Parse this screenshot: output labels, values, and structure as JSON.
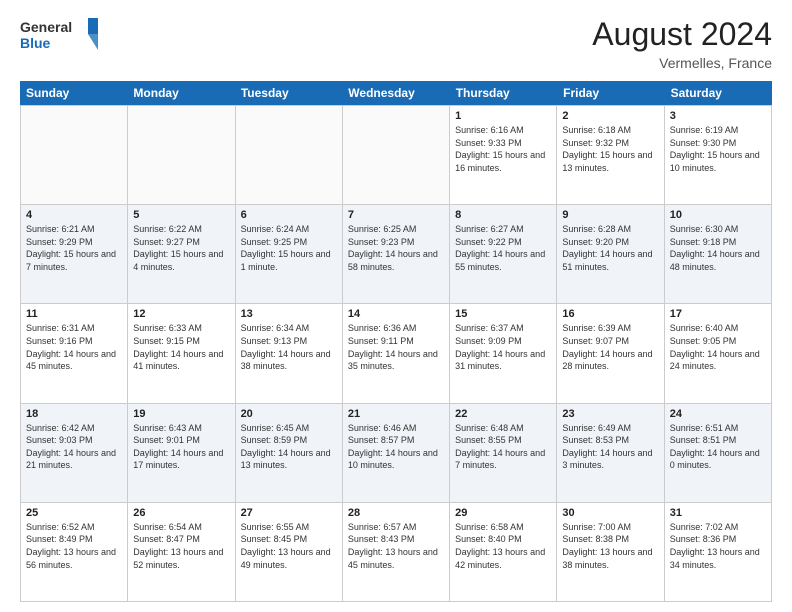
{
  "header": {
    "logo_general": "General",
    "logo_blue": "Blue",
    "month_title": "August 2024",
    "location": "Vermelles, France"
  },
  "weekdays": [
    "Sunday",
    "Monday",
    "Tuesday",
    "Wednesday",
    "Thursday",
    "Friday",
    "Saturday"
  ],
  "rows": [
    {
      "cells": [
        {
          "empty": true
        },
        {
          "empty": true
        },
        {
          "empty": true
        },
        {
          "empty": true
        },
        {
          "day": "1",
          "sunrise": "6:16 AM",
          "sunset": "9:33 PM",
          "daylight": "15 hours and 16 minutes."
        },
        {
          "day": "2",
          "sunrise": "6:18 AM",
          "sunset": "9:32 PM",
          "daylight": "15 hours and 13 minutes."
        },
        {
          "day": "3",
          "sunrise": "6:19 AM",
          "sunset": "9:30 PM",
          "daylight": "15 hours and 10 minutes."
        }
      ]
    },
    {
      "cells": [
        {
          "day": "4",
          "sunrise": "6:21 AM",
          "sunset": "9:29 PM",
          "daylight": "15 hours and 7 minutes."
        },
        {
          "day": "5",
          "sunrise": "6:22 AM",
          "sunset": "9:27 PM",
          "daylight": "15 hours and 4 minutes."
        },
        {
          "day": "6",
          "sunrise": "6:24 AM",
          "sunset": "9:25 PM",
          "daylight": "15 hours and 1 minute."
        },
        {
          "day": "7",
          "sunrise": "6:25 AM",
          "sunset": "9:23 PM",
          "daylight": "14 hours and 58 minutes."
        },
        {
          "day": "8",
          "sunrise": "6:27 AM",
          "sunset": "9:22 PM",
          "daylight": "14 hours and 55 minutes."
        },
        {
          "day": "9",
          "sunrise": "6:28 AM",
          "sunset": "9:20 PM",
          "daylight": "14 hours and 51 minutes."
        },
        {
          "day": "10",
          "sunrise": "6:30 AM",
          "sunset": "9:18 PM",
          "daylight": "14 hours and 48 minutes."
        }
      ]
    },
    {
      "cells": [
        {
          "day": "11",
          "sunrise": "6:31 AM",
          "sunset": "9:16 PM",
          "daylight": "14 hours and 45 minutes."
        },
        {
          "day": "12",
          "sunrise": "6:33 AM",
          "sunset": "9:15 PM",
          "daylight": "14 hours and 41 minutes."
        },
        {
          "day": "13",
          "sunrise": "6:34 AM",
          "sunset": "9:13 PM",
          "daylight": "14 hours and 38 minutes."
        },
        {
          "day": "14",
          "sunrise": "6:36 AM",
          "sunset": "9:11 PM",
          "daylight": "14 hours and 35 minutes."
        },
        {
          "day": "15",
          "sunrise": "6:37 AM",
          "sunset": "9:09 PM",
          "daylight": "14 hours and 31 minutes."
        },
        {
          "day": "16",
          "sunrise": "6:39 AM",
          "sunset": "9:07 PM",
          "daylight": "14 hours and 28 minutes."
        },
        {
          "day": "17",
          "sunrise": "6:40 AM",
          "sunset": "9:05 PM",
          "daylight": "14 hours and 24 minutes."
        }
      ]
    },
    {
      "cells": [
        {
          "day": "18",
          "sunrise": "6:42 AM",
          "sunset": "9:03 PM",
          "daylight": "14 hours and 21 minutes."
        },
        {
          "day": "19",
          "sunrise": "6:43 AM",
          "sunset": "9:01 PM",
          "daylight": "14 hours and 17 minutes."
        },
        {
          "day": "20",
          "sunrise": "6:45 AM",
          "sunset": "8:59 PM",
          "daylight": "14 hours and 13 minutes."
        },
        {
          "day": "21",
          "sunrise": "6:46 AM",
          "sunset": "8:57 PM",
          "daylight": "14 hours and 10 minutes."
        },
        {
          "day": "22",
          "sunrise": "6:48 AM",
          "sunset": "8:55 PM",
          "daylight": "14 hours and 7 minutes."
        },
        {
          "day": "23",
          "sunrise": "6:49 AM",
          "sunset": "8:53 PM",
          "daylight": "14 hours and 3 minutes."
        },
        {
          "day": "24",
          "sunrise": "6:51 AM",
          "sunset": "8:51 PM",
          "daylight": "14 hours and 0 minutes."
        }
      ]
    },
    {
      "cells": [
        {
          "day": "25",
          "sunrise": "6:52 AM",
          "sunset": "8:49 PM",
          "daylight": "13 hours and 56 minutes."
        },
        {
          "day": "26",
          "sunrise": "6:54 AM",
          "sunset": "8:47 PM",
          "daylight": "13 hours and 52 minutes."
        },
        {
          "day": "27",
          "sunrise": "6:55 AM",
          "sunset": "8:45 PM",
          "daylight": "13 hours and 49 minutes."
        },
        {
          "day": "28",
          "sunrise": "6:57 AM",
          "sunset": "8:43 PM",
          "daylight": "13 hours and 45 minutes."
        },
        {
          "day": "29",
          "sunrise": "6:58 AM",
          "sunset": "8:40 PM",
          "daylight": "13 hours and 42 minutes."
        },
        {
          "day": "30",
          "sunrise": "7:00 AM",
          "sunset": "8:38 PM",
          "daylight": "13 hours and 38 minutes."
        },
        {
          "day": "31",
          "sunrise": "7:02 AM",
          "sunset": "8:36 PM",
          "daylight": "13 hours and 34 minutes."
        }
      ]
    }
  ]
}
